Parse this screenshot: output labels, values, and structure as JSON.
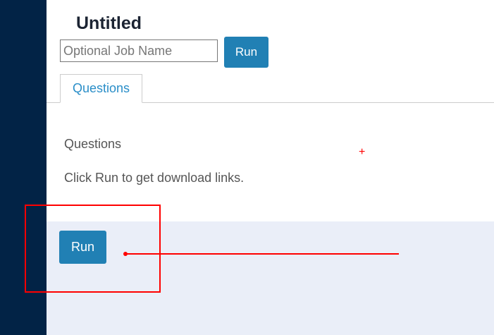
{
  "header": {
    "title": "Untitled",
    "job_name_placeholder": "Optional Job Name",
    "job_name_value": "",
    "run_label": "Run"
  },
  "tabs": [
    {
      "label": "Questions",
      "active": true
    }
  ],
  "content": {
    "heading": "Questions",
    "message": "Click Run to get download links."
  },
  "footer": {
    "run_label": "Run"
  },
  "colors": {
    "sidebar": "#022346",
    "accent": "#2180b4",
    "footer_bg": "#eaeef8",
    "annotation": "#ff0000"
  }
}
